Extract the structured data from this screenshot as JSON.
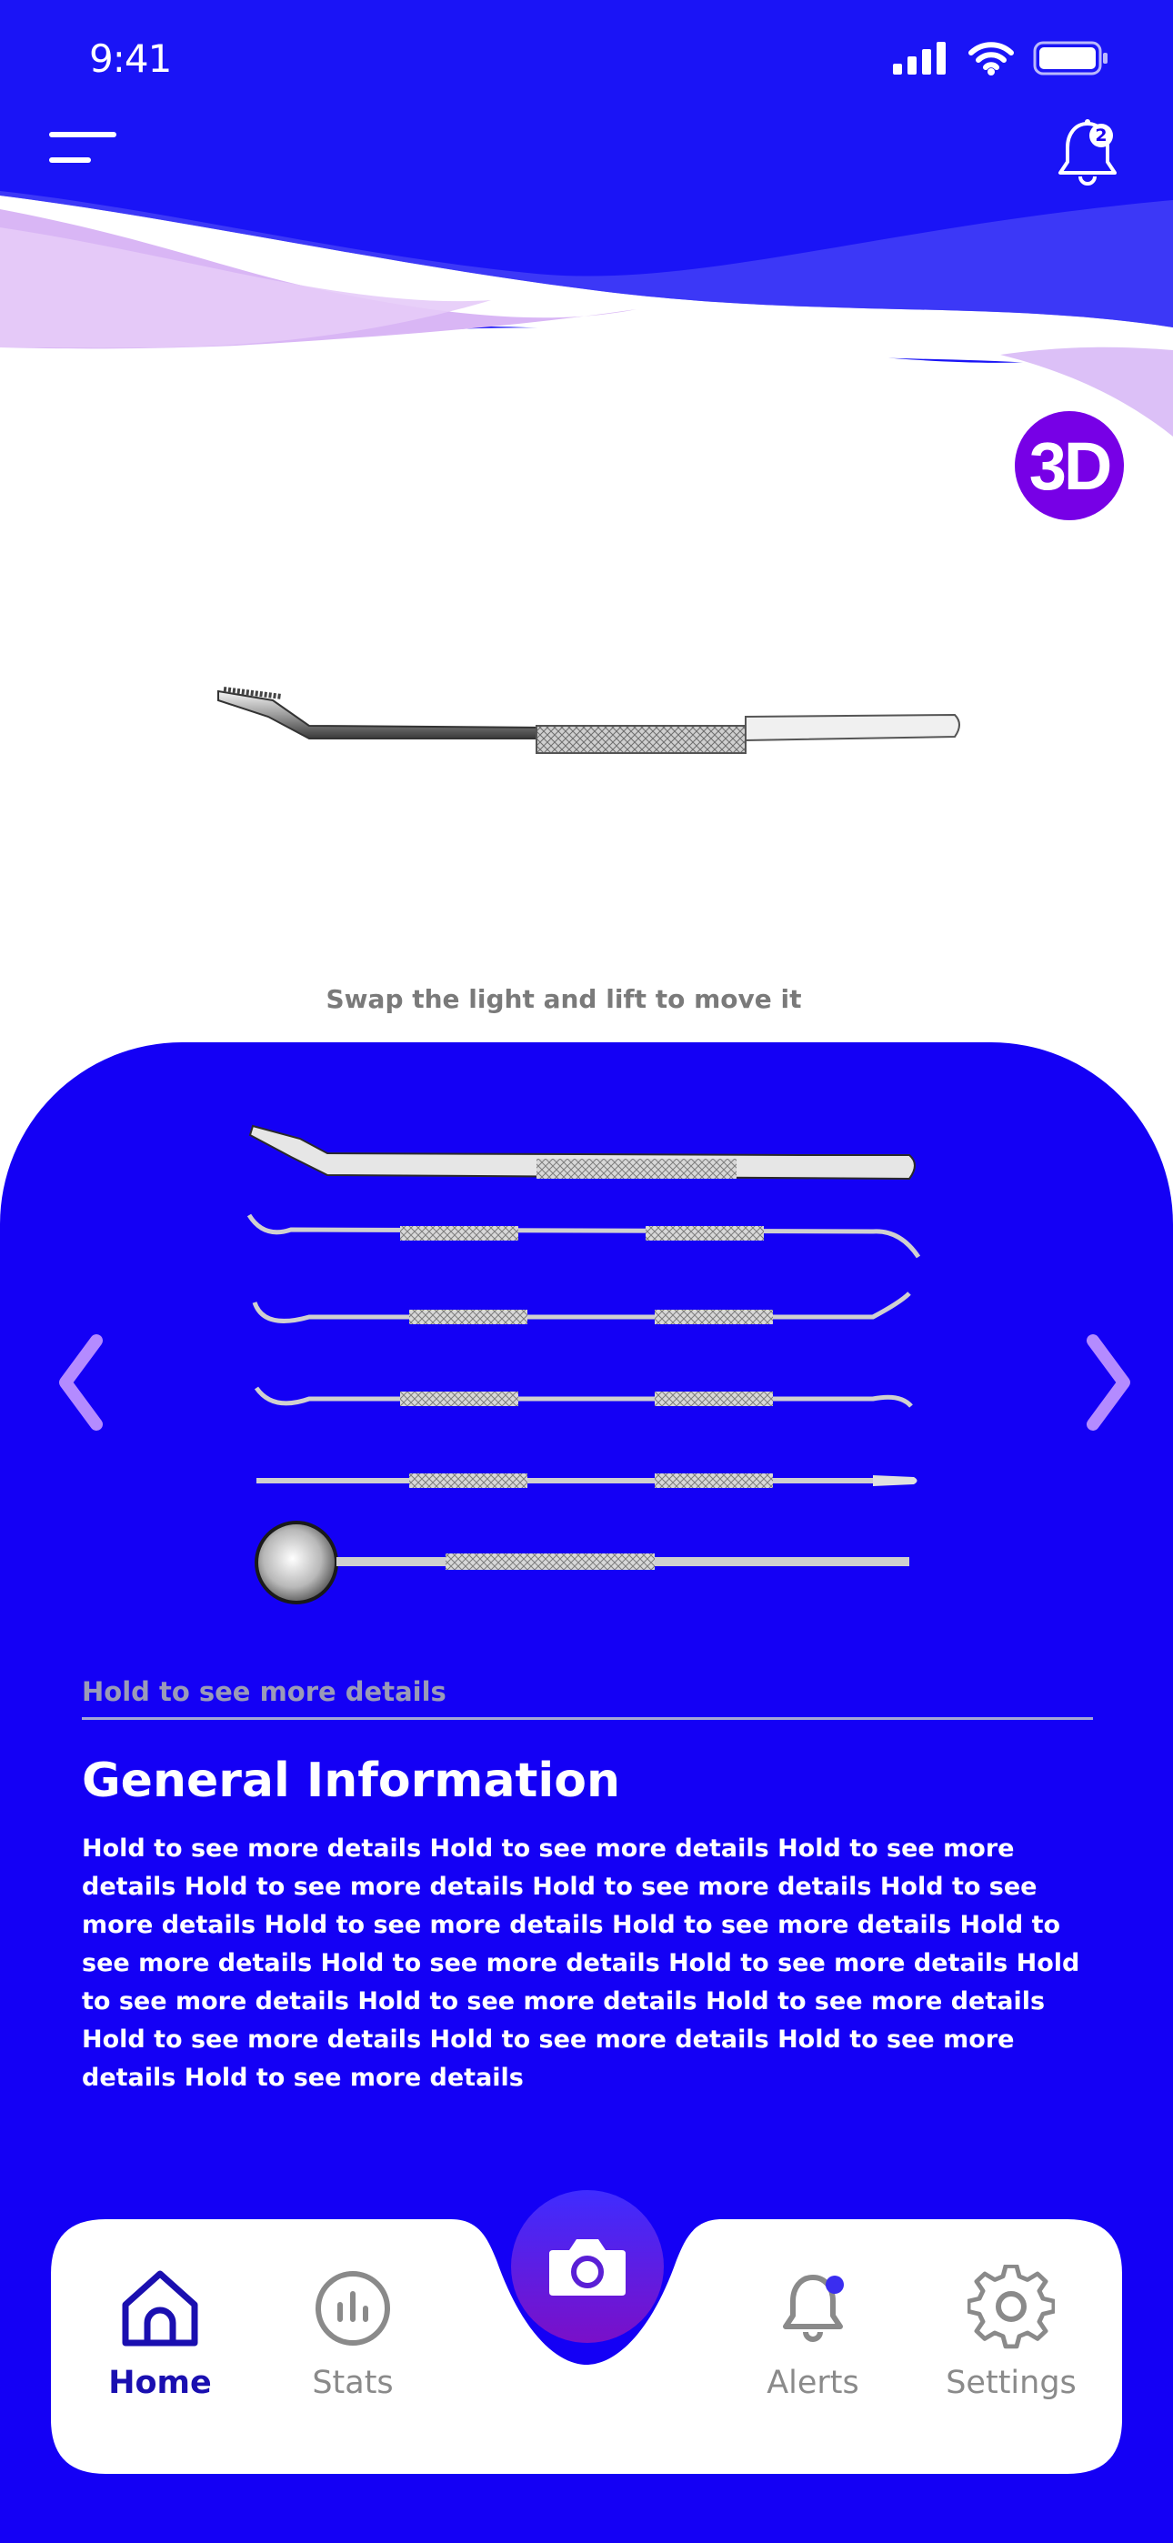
{
  "status_bar": {
    "time": "9:41"
  },
  "header": {
    "notification_count": "2"
  },
  "viewer": {
    "mode_badge": "3D",
    "hint": "Swap the light and lift to move it"
  },
  "details": {
    "sub_label": "Hold to see more details",
    "section_title": "General Information",
    "body": "Hold to see more details Hold to see more details Hold to see more details Hold to see more details Hold to see more details Hold to see more details Hold to see more details Hold to see more details Hold to see more details Hold to see more details Hold to see more details Hold to see more details Hold to see more details Hold to see more details Hold to see more details Hold to see more details Hold to see more details Hold to see more details"
  },
  "tabbar": {
    "home": "Home",
    "stats": "Stats",
    "alerts": "Alerts",
    "settings": "Settings"
  },
  "colors": {
    "primary": "#1400f5",
    "accent_purple": "#7700e6",
    "wave_light": "#d9b6f5",
    "active_tab": "#1a0fb0"
  },
  "icons": {
    "menu": "hamburger-icon",
    "notifications": "bell-icon",
    "prev": "chevron-left-icon",
    "next": "chevron-right-icon",
    "camera": "camera-icon",
    "home": "home-icon",
    "stats": "chart-icon",
    "alerts": "bell-icon",
    "settings": "gear-icon"
  }
}
